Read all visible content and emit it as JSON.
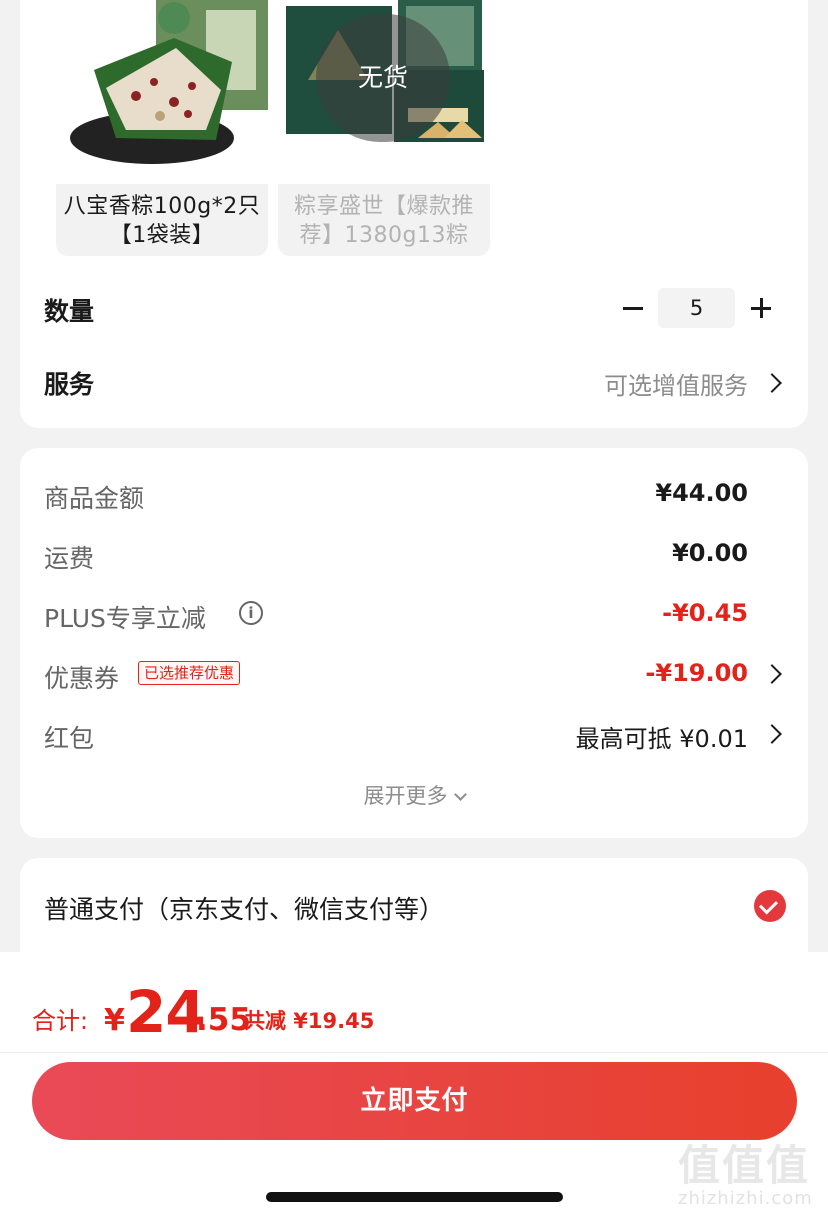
{
  "product": {
    "options": [
      {
        "name_line1": "八宝香粽100g*2只",
        "name_line2": "【1袋装】",
        "sold_out": false
      },
      {
        "name_line1": "粽享盛世【爆款推",
        "name_line2": "荐】1380g13粽",
        "sold_out": true
      }
    ],
    "sold_out_label": "无货",
    "quantity_label": "数量",
    "quantity_value": "5",
    "service_label": "服务",
    "service_value": "可选增值服务"
  },
  "price": {
    "goods_label": "商品金额",
    "goods_value": "¥44.00",
    "shipping_label": "运费",
    "shipping_value": "¥0.00",
    "plus_label": "PLUS专享立减",
    "plus_value": "-¥0.45",
    "coupon_label": "优惠券",
    "coupon_tag": "已选推荐优惠",
    "coupon_value": "-¥19.00",
    "redpacket_label": "红包",
    "redpacket_value": "最高可抵 ¥0.01",
    "expand_label": "展开更多"
  },
  "payment": {
    "method_label": "普通支付（京东支付、微信支付等）",
    "selected": true
  },
  "footer": {
    "total_label": "合计:",
    "total_yen": "¥",
    "total_int": "24",
    "total_dec": ".55",
    "savings": "共减 ¥19.45",
    "pay_button": "立即支付"
  },
  "watermark": {
    "big": "值值值",
    "small": "zhizhizhi.com"
  },
  "colors": {
    "accent_red": "#e2231a",
    "button_gradient_start": "#e94a57",
    "button_gradient_end": "#e8402d",
    "check_red": "#e4393c"
  }
}
